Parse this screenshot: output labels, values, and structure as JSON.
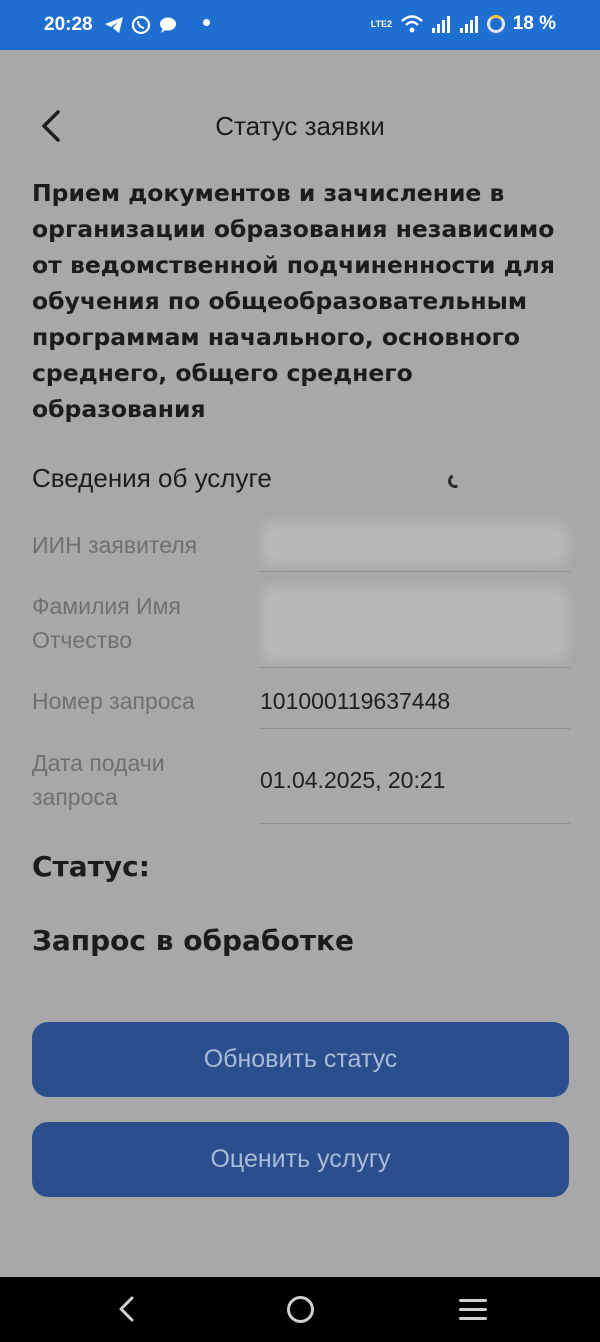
{
  "status_bar": {
    "time": "20:28",
    "network_badge": "LTE2",
    "battery_percent": "18 %",
    "accent_color": "#1f6fd1"
  },
  "header": {
    "title": "Статус заявки",
    "back_icon": "chevron-left-icon"
  },
  "service": {
    "title": "Прием документов и зачисление в организации образования независимо от ведомственной подчиненности для обучения по общеобразовательным программам начального, основного среднего, общего среднего образования"
  },
  "details": {
    "heading": "Сведения об услуге",
    "fields": [
      {
        "label": "ИИН заявителя",
        "value": ""
      },
      {
        "label": "Фамилия Имя Отчество",
        "value": ""
      },
      {
        "label": "Номер запроса",
        "value": "101000119637448"
      },
      {
        "label": "Дата подачи запроса",
        "value": "01.04.2025, 20:21"
      }
    ]
  },
  "status": {
    "label": "Статус:",
    "value": "Запрос в обработке"
  },
  "actions": {
    "refresh_label": "Обновить статус",
    "rate_label": "Оценить услугу",
    "button_color": "#2a4f8c"
  }
}
